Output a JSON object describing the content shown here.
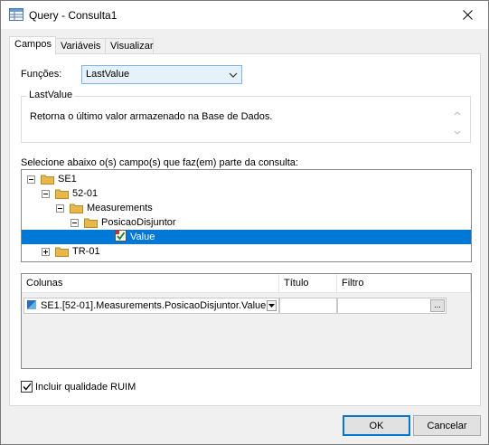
{
  "window": {
    "title": "Query - Consulta1",
    "close_label": "✕"
  },
  "tabs": [
    {
      "label": "Campos"
    },
    {
      "label": "Variáveis"
    },
    {
      "label": "Visualizar"
    }
  ],
  "functions": {
    "label": "Funções:",
    "selected": "LastValue"
  },
  "description_group": {
    "legend": "LastValue",
    "text": "Retorna o último valor armazenado na Base de Dados."
  },
  "tree": {
    "label": "Selecione abaixo o(s) campo(s) que faz(em) parte da consulta:",
    "nodes": [
      {
        "label": "SE1"
      },
      {
        "label": "52-01"
      },
      {
        "label": "Measurements"
      },
      {
        "label": "PosicaoDisjuntor"
      },
      {
        "label": "Value"
      },
      {
        "label": "TR-01"
      }
    ]
  },
  "grid": {
    "headers": [
      "Colunas",
      "Título",
      "Filtro"
    ],
    "rows": [
      {
        "column": "SE1.[52-01].Measurements.PosicaoDisjuntor.Value",
        "title": "",
        "filter": ""
      }
    ],
    "ellipsis_label": "..."
  },
  "checkbox": {
    "label": "Incluir qualidade RUIM",
    "checked": true
  },
  "buttons": {
    "ok": "OK",
    "cancel": "Cancelar"
  },
  "colors": {
    "selection": "#0078d7",
    "folder": "#e8b84a",
    "combo_bg": "#e5f1fb"
  }
}
